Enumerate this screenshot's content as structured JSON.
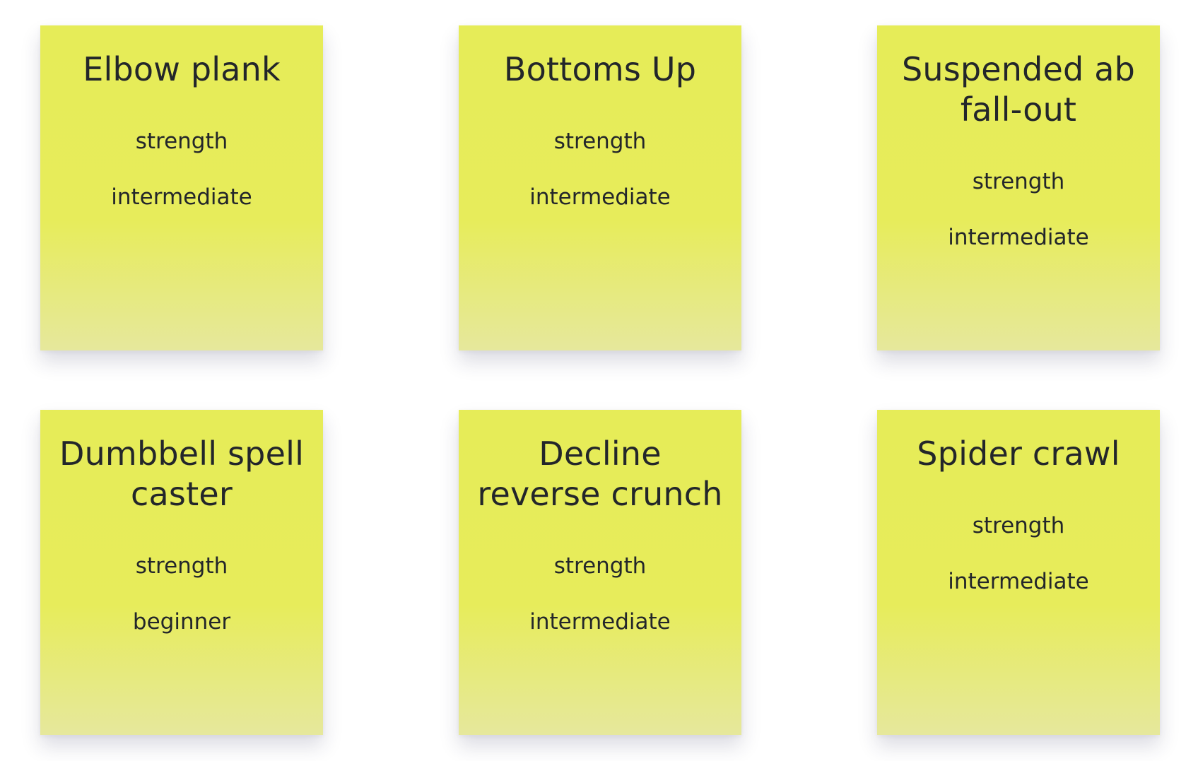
{
  "exercises": [
    {
      "name": "Elbow plank",
      "category": "strength",
      "level": "intermediate"
    },
    {
      "name": "Bottoms Up",
      "category": "strength",
      "level": "intermediate"
    },
    {
      "name": "Suspended ab fall-out",
      "category": "strength",
      "level": "intermediate"
    },
    {
      "name": "Dumbbell spell caster",
      "category": "strength",
      "level": "beginner"
    },
    {
      "name": "Decline reverse crunch",
      "category": "strength",
      "level": "intermediate"
    },
    {
      "name": "Spider crawl",
      "category": "strength",
      "level": "intermediate"
    }
  ]
}
